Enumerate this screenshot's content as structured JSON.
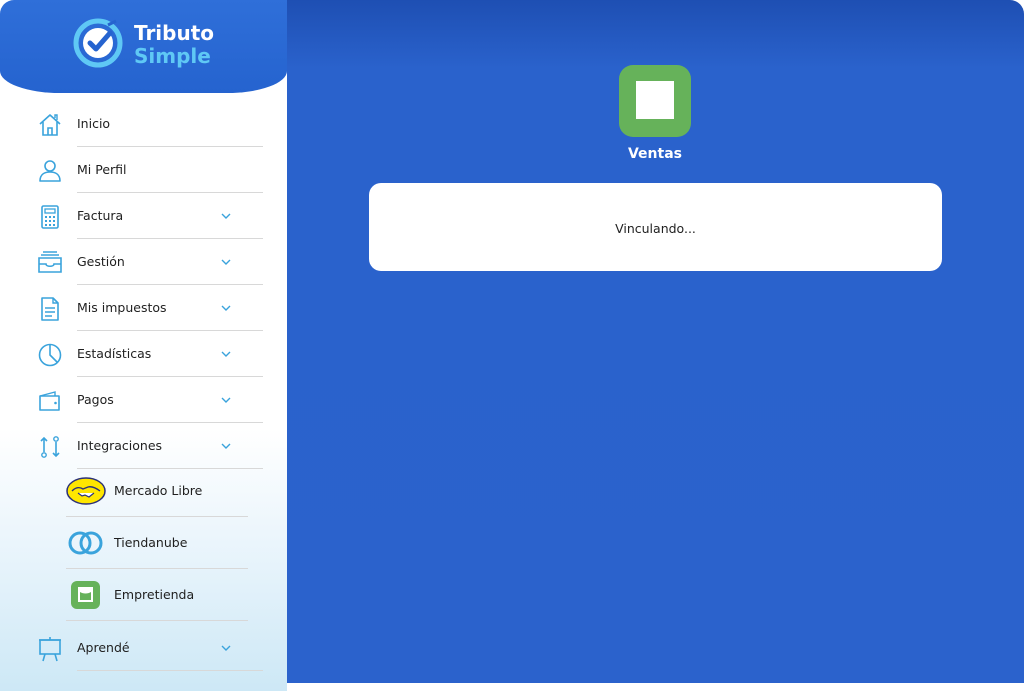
{
  "brand": {
    "line1": "Tributo",
    "line2": "Simple",
    "color_primary": "#2563cf",
    "color_accent": "#5fc8f5"
  },
  "sidebar": {
    "items": [
      {
        "label": "Inicio",
        "icon": "home-icon",
        "has_chevron": false
      },
      {
        "label": "Mi Perfil",
        "icon": "user-icon",
        "has_chevron": false
      },
      {
        "label": "Factura",
        "icon": "calculator-icon",
        "has_chevron": true
      },
      {
        "label": "Gestión",
        "icon": "inbox-icon",
        "has_chevron": true
      },
      {
        "label": "Mis impuestos",
        "icon": "document-icon",
        "has_chevron": true
      },
      {
        "label": "Estadísticas",
        "icon": "pie-chart-icon",
        "has_chevron": true
      },
      {
        "label": "Pagos",
        "icon": "wallet-icon",
        "has_chevron": true
      },
      {
        "label": "Integraciones",
        "icon": "swap-icon",
        "has_chevron": true,
        "expanded": true
      }
    ],
    "sub_items": [
      {
        "label": "Mercado Libre",
        "icon": "mercado-libre-logo-icon"
      },
      {
        "label": "Tiendanube",
        "icon": "tiendanube-logo-icon"
      },
      {
        "label": "Empretienda",
        "icon": "empretienda-logo-icon"
      }
    ],
    "after_items": [
      {
        "label": "Aprendé",
        "icon": "presentation-board-icon",
        "has_chevron": true
      }
    ]
  },
  "main": {
    "app_icon": "empretienda-bag-icon",
    "app_icon_color": "#66b25a",
    "title": "Ventas",
    "status_text": "Vinculando..."
  },
  "colors": {
    "main_bg": "#2b62cc",
    "icon_blue": "#3aa3dc"
  }
}
